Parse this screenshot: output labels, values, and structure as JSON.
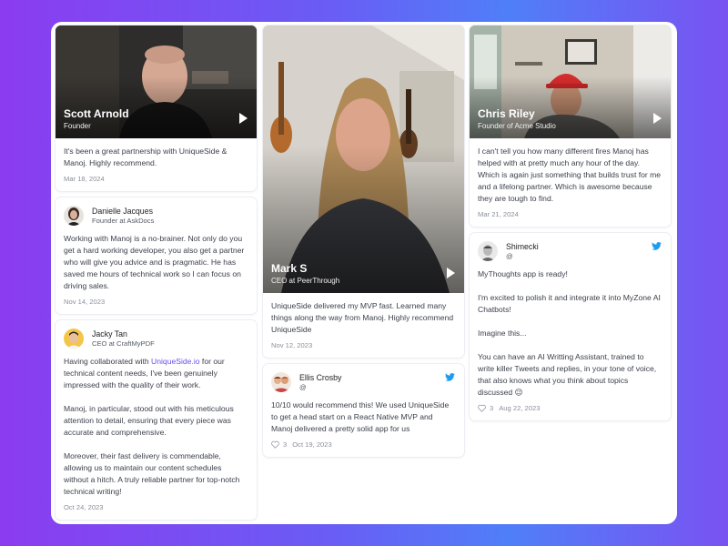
{
  "testimonials": {
    "scott": {
      "name": "Scott Arnold",
      "role": "Founder",
      "text": "It's been a great partnership with UniqueSide & Manoj. Highly recommend.",
      "date": "Mar 18, 2024"
    },
    "danielle": {
      "name": "Danielle Jacques",
      "role": "Founder at AskDocs",
      "text": "Working with Manoj is a no-brainer. Not only do you get a hard working developer, you also get a partner who will give you advice and is pragmatic. He has saved me hours of technical work so I can focus on driving sales.",
      "date": "Nov 14, 2023"
    },
    "jacky": {
      "name": "Jacky Tan",
      "role": "CEO at CraftMyPDF",
      "text_prefix": "Having collaborated with ",
      "link": "UniqueSide.io",
      "text_suffix": " for our technical content needs, I've been genuinely impressed with the quality of their work.\n\nManoj, in particular, stood out with his meticulous attention to detail, ensuring that every piece was accurate and comprehensive.\n\nMoreover, their fast delivery is commendable, allowing us to maintain our content schedules without a hitch. A truly reliable partner for top-notch technical writing!",
      "date": "Oct 24, 2023"
    },
    "mark": {
      "name": "Mark S",
      "role": "CEO at PeerThrough",
      "text": "UniqueSide delivered my MVP fast. Learned many things along the way from Manoj. Highly recommend UniqueSide",
      "date": "Nov 12, 2023"
    },
    "ellis": {
      "name": "Ellis Crosby",
      "handle": "@",
      "text": "10/10 would recommend this! We used UniqueSide to get a head start on a React Native MVP and Manoj delivered a pretty solid app for us",
      "likes": "3",
      "date": "Oct 19, 2023"
    },
    "chris": {
      "name": "Chris Riley",
      "role": "Founder of Acme Studio",
      "text": "I can't tell you how many different fires Manoj has helped with at pretty much any hour of the day. Which is again just something that builds trust for me and a lifelong partner. Which is awesome because they are tough to find.",
      "date": "Mar 21, 2024"
    },
    "shimecki": {
      "name": "Shimecki",
      "handle": "@",
      "text": "MyThoughts app is ready!\n\nI'm excited to polish it and integrate it into MyZone AI Chatbots!\n\nImagine this...\n\nYou can have an AI Writting Assistant, trained to write killer Tweets and replies, in your tone of voice, that also knows what you think about topics discussed 😉",
      "likes": "3",
      "date": "Aug 22, 2023"
    }
  },
  "colors": {
    "accent_link": "#6b4ef0",
    "twitter_blue": "#1d9bf0"
  },
  "icons": {
    "play": "play-icon",
    "twitter": "twitter-icon",
    "heart": "heart-icon"
  }
}
